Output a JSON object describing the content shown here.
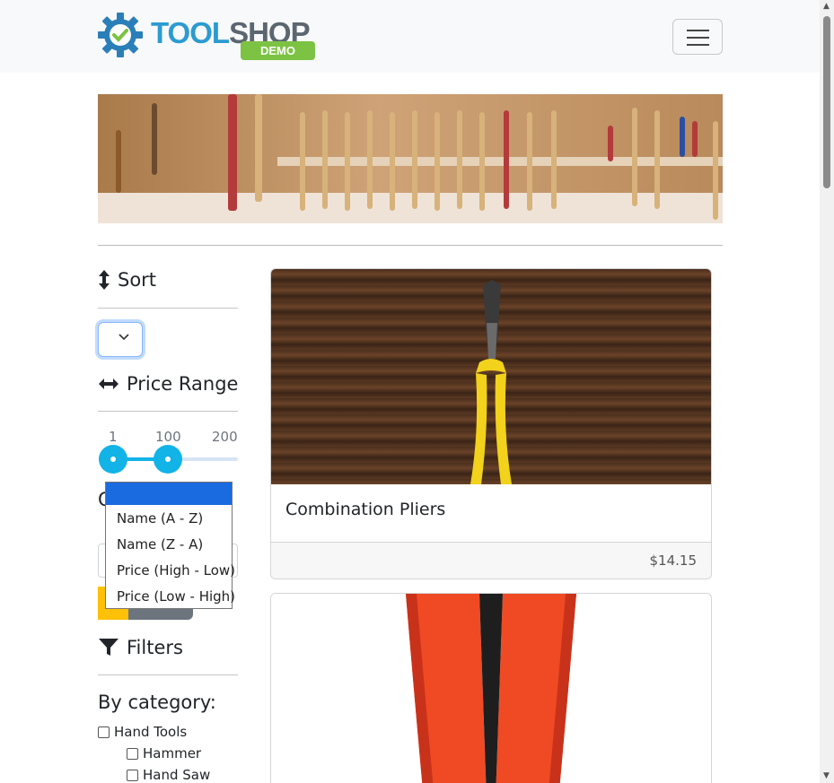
{
  "brand": {
    "word_a": "TOOL",
    "word_b": "SHOP",
    "badge": "DEMO"
  },
  "sidebar": {
    "sort_heading": "Sort",
    "sort_select_value": "",
    "price_heading": "Price Range",
    "slider": {
      "min_label": "1",
      "mid_label": "100",
      "max_label": "200",
      "low": 1,
      "high": 100,
      "min": 1,
      "max": 200
    },
    "search_heading_stub": "C",
    "filters_heading": "Filters",
    "by_category": "By category:",
    "categories": [
      {
        "label": "Hand Tools",
        "checked": false
      },
      {
        "label": "Hammer",
        "checked": false
      },
      {
        "label": "Hand Saw",
        "checked": false
      }
    ]
  },
  "sort_dropdown": {
    "options": [
      "",
      "Name (A - Z)",
      "Name (Z - A)",
      "Price (High - Low)",
      "Price (Low - High)"
    ],
    "highlighted_index": 0
  },
  "products": [
    {
      "name": "Combination Pliers",
      "price": "$14.15"
    },
    {
      "name": "",
      "price": ""
    }
  ],
  "colors": {
    "accent": "#12b3e6",
    "focus": "#86b7fe",
    "highlight": "#1a6ae0",
    "warning": "#ffc107",
    "secondary": "#6c757d"
  }
}
